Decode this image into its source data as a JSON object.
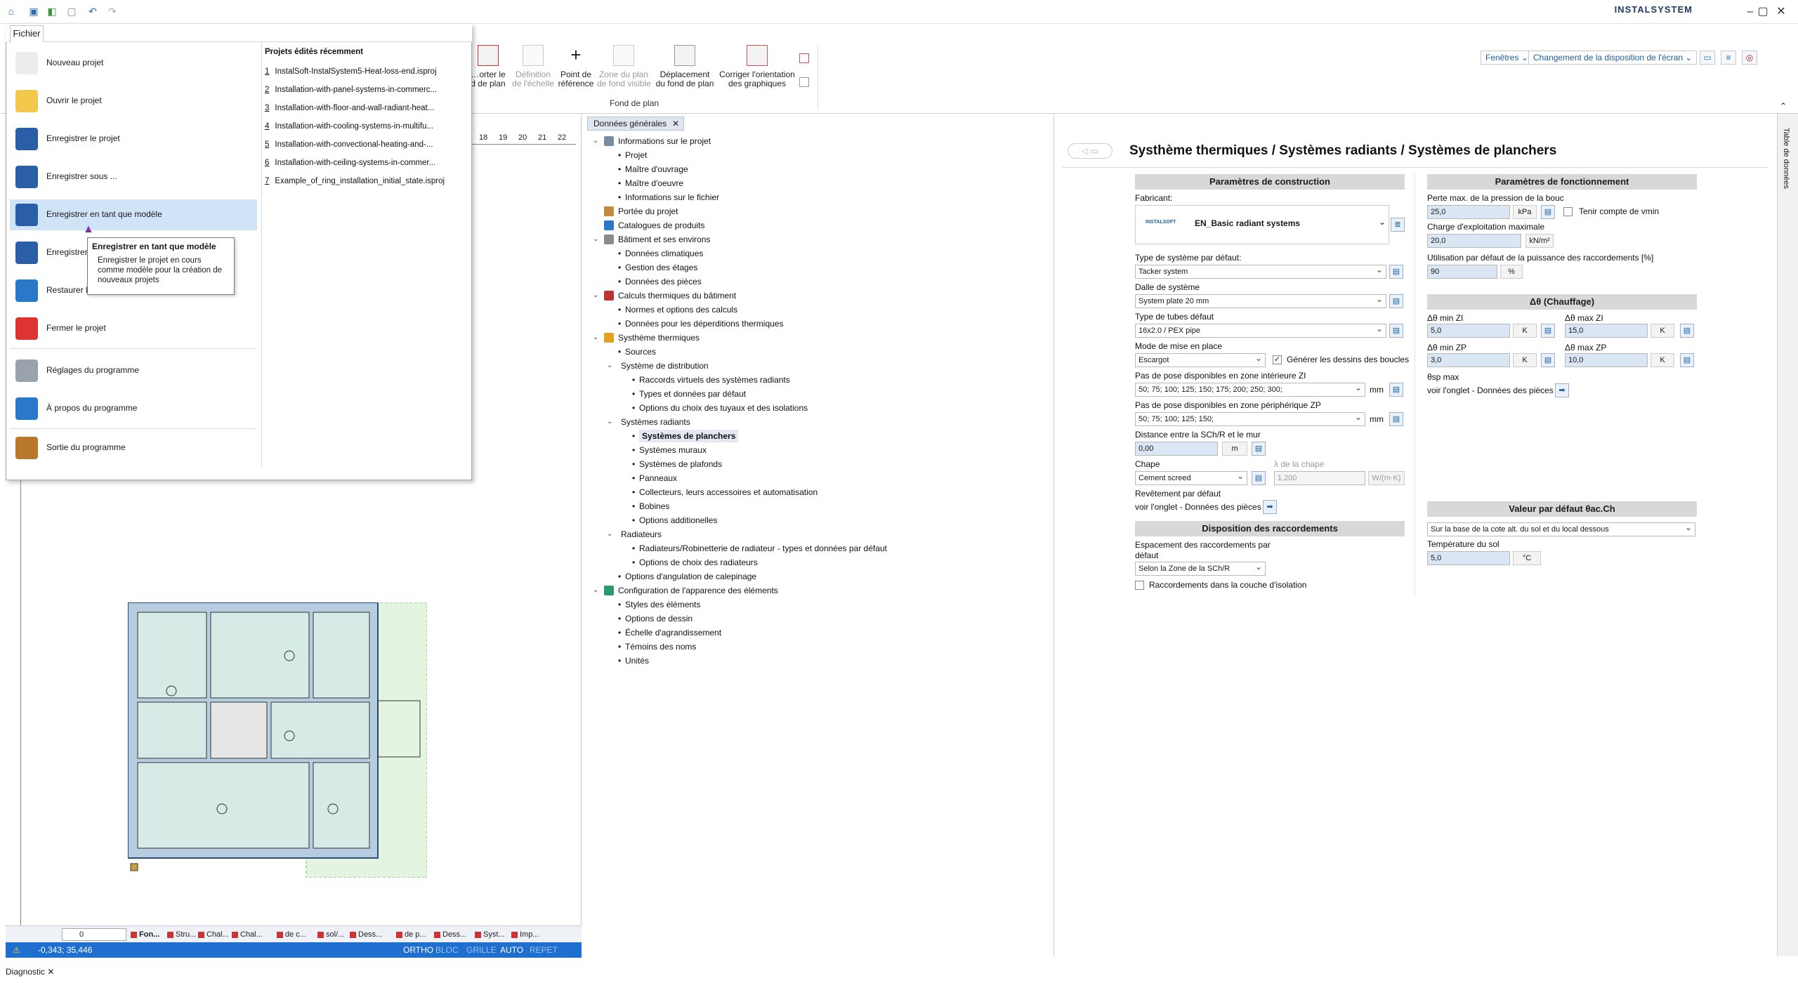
{
  "app": {
    "brand": "INSTALSYSTEM"
  },
  "toolbar": {
    "windows_label": "Fenêtres",
    "layout_label": "Changement de la disposition de l'écran"
  },
  "ribbon": {
    "buttons": [
      {
        "label": "…orter le\nd de plan",
        "enabled": true
      },
      {
        "label": "Définition\nde l'échelle",
        "enabled": false
      },
      {
        "label": "Point de\nréférence",
        "enabled": true
      },
      {
        "label": "Zone du plan\nde fond visible",
        "enabled": false
      },
      {
        "label": "Déplacement\ndu fond de plan",
        "enabled": true
      },
      {
        "label": "Corriger l'orientation\ndes graphiques",
        "enabled": true
      }
    ],
    "group_label": "Fond de plan"
  },
  "file_menu": {
    "tab": "Fichier",
    "items": [
      {
        "label": "Nouveau projet",
        "icon": "new-document-icon"
      },
      {
        "label": "Ouvrir le projet",
        "icon": "folder-open-icon"
      },
      {
        "label": "Enregistrer le projet",
        "icon": "save-icon"
      },
      {
        "label": "Enregistrer sous ...",
        "icon": "save-as-icon"
      },
      {
        "label": "Enregistrer en tant que modèle",
        "icon": "save-template-icon"
      },
      {
        "label": "Enregistrer",
        "icon": "save-icon"
      },
      {
        "label": "Restaurer l",
        "icon": "restore-icon"
      },
      {
        "label": "Fermer le projet",
        "icon": "close-project-icon"
      },
      {
        "label": "Réglages du programme",
        "icon": "settings-icon"
      },
      {
        "label": "À propos du programme",
        "icon": "info-icon"
      },
      {
        "label": "Sortie du programme",
        "icon": "exit-icon"
      }
    ],
    "recent_title": "Projets édités récemment",
    "recent": [
      {
        "n": "1",
        "name": "InstalSoft-InstalSystem5-Heat-loss-end.isproj"
      },
      {
        "n": "2",
        "name": "Installation-with-panel-systems-in-commerc..."
      },
      {
        "n": "3",
        "name": "Installation-with-floor-and-wall-radiant-heat..."
      },
      {
        "n": "4",
        "name": "Installation-with-cooling-systems-in-multifu..."
      },
      {
        "n": "5",
        "name": "Installation-with-convectional-heating-and-..."
      },
      {
        "n": "6",
        "name": "Installation-with-ceiling-systems-in-commer..."
      },
      {
        "n": "7",
        "name": "Example_of_ring_installation_initial_state.isproj"
      }
    ],
    "tooltip": {
      "title": "Enregistrer en tant que modèle",
      "body": "Enregistrer le projet en cours comme modèle pour la création de nouveaux projets"
    }
  },
  "cad": {
    "ruler_ticks": [
      "18",
      "19",
      "20",
      "21",
      "22"
    ],
    "layer_value": "0",
    "tabs": [
      "Fon...",
      "Stru...",
      "Chal...",
      "Chal...",
      "de c...",
      "sol/...",
      "Dess...",
      "de p...",
      "Dess...",
      "Syst...",
      "Imp..."
    ],
    "coords": "-0,343; 35,446",
    "modes": [
      {
        "label": "ORTHO",
        "on": true
      },
      {
        "label": "BLOC",
        "on": false
      },
      {
        "label": "GRILLE",
        "on": false
      },
      {
        "label": "AUTO",
        "on": true
      },
      {
        "label": "REPET",
        "on": false
      }
    ],
    "diagnostic": "Diagnostic"
  },
  "tree": {
    "tab": "Données générales",
    "nodes": [
      {
        "label": "Informations sur le projet",
        "level": 0,
        "toggle": "open",
        "icon": "info-icon"
      },
      {
        "label": "Projet",
        "level": 1
      },
      {
        "label": "Maître d'ouvrage",
        "level": 1
      },
      {
        "label": "Maître d'oeuvre",
        "level": 1
      },
      {
        "label": "Informations sur le fichier",
        "level": 1
      },
      {
        "label": "Portée du projet",
        "level": 0,
        "icon": "scope-icon"
      },
      {
        "label": "Catalogues de produits",
        "level": 0,
        "icon": "catalog-icon"
      },
      {
        "label": "Bâtiment et ses environs",
        "level": 0,
        "toggle": "open",
        "icon": "building-icon"
      },
      {
        "label": "Données climatiques",
        "level": 1
      },
      {
        "label": "Gestion des étages",
        "level": 1
      },
      {
        "label": "Données des pièces",
        "level": 1
      },
      {
        "label": "Calculs thermiques du bâtiment",
        "level": 0,
        "toggle": "open",
        "icon": "calc-icon"
      },
      {
        "label": "Normes et options des calculs",
        "level": 1
      },
      {
        "label": "Données pour les déperditions thermiques",
        "level": 1
      },
      {
        "label": "Systhème thermiques",
        "level": 0,
        "toggle": "open",
        "icon": "thermal-icon"
      },
      {
        "label": "Sources",
        "level": 1
      },
      {
        "label": "Système de distribution",
        "level": 1,
        "toggle": "open"
      },
      {
        "label": "Raccords virtuels des systèmes radiants",
        "level": 2
      },
      {
        "label": "Types et données par défaut",
        "level": 2
      },
      {
        "label": "Options du choix des tuyaux et des isolations",
        "level": 2
      },
      {
        "label": "Systèmes radiants",
        "level": 1,
        "toggle": "open"
      },
      {
        "label": "Systèmes de planchers",
        "level": 2,
        "selected": true
      },
      {
        "label": "Systèmes muraux",
        "level": 2
      },
      {
        "label": "Systèmes de plafonds",
        "level": 2
      },
      {
        "label": "Panneaux",
        "level": 2
      },
      {
        "label": "Collecteurs, leurs accessoires et automatisation",
        "level": 2
      },
      {
        "label": "Bobines",
        "level": 2
      },
      {
        "label": "Options additionelles",
        "level": 2
      },
      {
        "label": "Radiateurs",
        "level": 1,
        "toggle": "open"
      },
      {
        "label": "Radiateurs/Robinetterie de radiateur - types et données par défaut",
        "level": 2
      },
      {
        "label": "Options de choix des radiateurs",
        "level": 2
      },
      {
        "label": "Options d'angulation de calepinage",
        "level": 1
      },
      {
        "label": "Configuration de l'apparence des éléments",
        "level": 0,
        "toggle": "open",
        "icon": "appearance-icon"
      },
      {
        "label": "Styles des éléments",
        "level": 1
      },
      {
        "label": "Options de dessin",
        "level": 1
      },
      {
        "label": "Échelle d'agrandissement",
        "level": 1
      },
      {
        "label": "Témoins des noms",
        "level": 1
      },
      {
        "label": "Unités",
        "level": 1
      }
    ]
  },
  "form": {
    "title": "Systhème thermiques / Systèmes radiants / Systèmes de planchers",
    "construction": {
      "header": "Paramètres de construction",
      "manufacturer_label": "Fabricant:",
      "manufacturer_logo": "INSTALSOFT",
      "manufacturer_value": "EN_Basic radiant systems",
      "system_type_label": "Type de système par défaut:",
      "system_type_value": "Tacker system",
      "slab_label": "Dalle de système",
      "slab_value": "System plate 20 mm",
      "pipe_label": "Type de tubes défaut",
      "pipe_value": "16x2.0 / PEX pipe",
      "laying_label": "Mode de mise en place",
      "laying_value": "Escargot",
      "generate_loops_label": "Générer les dessins des boucles",
      "pitch_zi_label": "Pas de pose disponibles en zone intérieure ZI",
      "pitch_zi_value": "50; 75; 100; 125; 150; 175; 200; 250; 300;",
      "pitch_zp_label": "Pas de pose disponibles en zone périphérique ZP",
      "pitch_zp_value": "50; 75; 100; 125; 150;",
      "unit_mm": "mm",
      "distance_label": "Distance entre la SCh/R et le mur",
      "distance_value": "0,00",
      "unit_m": "m",
      "screed_label": "Chape",
      "screed_value": "Cement screed",
      "lambda_label": "λ de la chape",
      "lambda_value": "1,200",
      "lambda_unit": "W/(m·K)",
      "covering_label": "Revêtement par défaut",
      "covering_hint": "voir l'onglet - Données des pièces"
    },
    "connections": {
      "header": "Disposition des raccordements",
      "spacing_label": "Espacement des raccordements par défaut",
      "spacing_value": "Selon la Zone de la SCh/R",
      "insulation_label": "Raccordements dans la couche d'isolation"
    },
    "operation": {
      "header": "Paramètres de fonctionnement",
      "pressure_label": "Perte max. de la pression de la bouc",
      "pressure_value": "25,0",
      "pressure_unit": "kPa",
      "vmin_label": "Tenir compte de vmin",
      "load_label": "Charge d'exploitation maximale",
      "load_value": "20,0",
      "load_unit": "kN/m²",
      "usage_label": "Utilisation par défaut de la puissance des raccordements [%]",
      "usage_value": "90",
      "usage_unit": "%"
    },
    "heating": {
      "header": "Δθ (Chauffage)",
      "min_zi_label": "Δθ min ZI",
      "min_zi_value": "5,0",
      "max_zi_label": "Δθ max ZI",
      "max_zi_value": "15,0",
      "min_zp_label": "Δθ min ZP",
      "min_zp_value": "3,0",
      "max_zp_label": "Δθ max ZP",
      "max_zp_value": "10,0",
      "unit_k": "K",
      "theta_label": "θsp max",
      "theta_hint": "voir l'onglet - Données des pièces"
    },
    "default_value": {
      "header": "Valeur par défaut θac.Ch",
      "basis_value": "Sur la base de la cote alt. du sol et du local dessous",
      "soil_label": "Température du sol",
      "soil_value": "5,0",
      "soil_unit": "°C"
    }
  },
  "side": {
    "label": "Table de données"
  }
}
